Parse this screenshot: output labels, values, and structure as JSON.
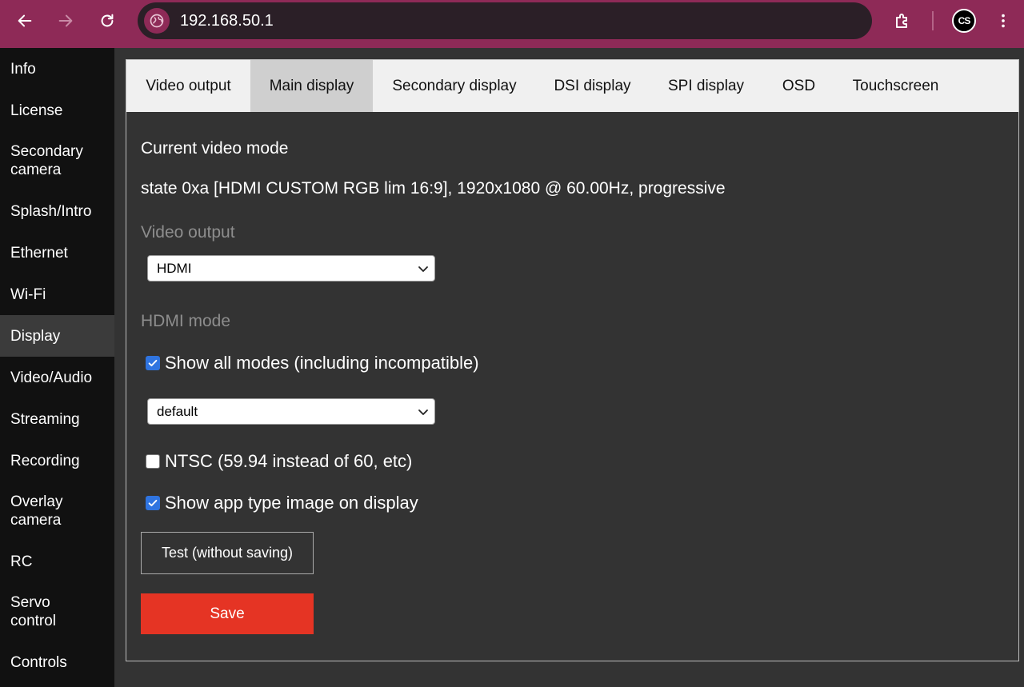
{
  "browser": {
    "url": "192.168.50.1",
    "profile_initials": "CS",
    "accent_color": "#8e2a57"
  },
  "sidebar": {
    "items": [
      {
        "label": "Info"
      },
      {
        "label": "License"
      },
      {
        "label": "Secondary camera"
      },
      {
        "label": "Splash/Intro"
      },
      {
        "label": "Ethernet"
      },
      {
        "label": "Wi-Fi"
      },
      {
        "label": "Display",
        "active": true
      },
      {
        "label": "Video/Audio"
      },
      {
        "label": "Streaming"
      },
      {
        "label": "Recording"
      },
      {
        "label": "Overlay camera"
      },
      {
        "label": "RC"
      },
      {
        "label": "Servo control"
      },
      {
        "label": "Controls"
      }
    ]
  },
  "tabs": [
    {
      "label": "Video output"
    },
    {
      "label": "Main display",
      "active": true
    },
    {
      "label": "Secondary display"
    },
    {
      "label": "DSI display"
    },
    {
      "label": "SPI display"
    },
    {
      "label": "OSD"
    },
    {
      "label": "Touchscreen"
    }
  ],
  "main": {
    "current_mode_title": "Current video mode",
    "current_mode_value": "state 0xa [HDMI CUSTOM RGB lim 16:9], 1920x1080 @ 60.00Hz, progressive",
    "video_output_label": "Video output",
    "video_output_value": "HDMI",
    "hdmi_mode_label": "HDMI mode",
    "show_all_modes_label": "Show all modes (including incompatible)",
    "show_all_modes_checked": true,
    "hdmi_mode_value": "default",
    "ntsc_label": "NTSC (59.94 instead of 60, etc)",
    "ntsc_checked": false,
    "show_app_type_label": "Show app type image on display",
    "show_app_type_checked": true,
    "test_button": "Test (without saving)",
    "save_button": "Save",
    "save_color": "#e53424"
  }
}
